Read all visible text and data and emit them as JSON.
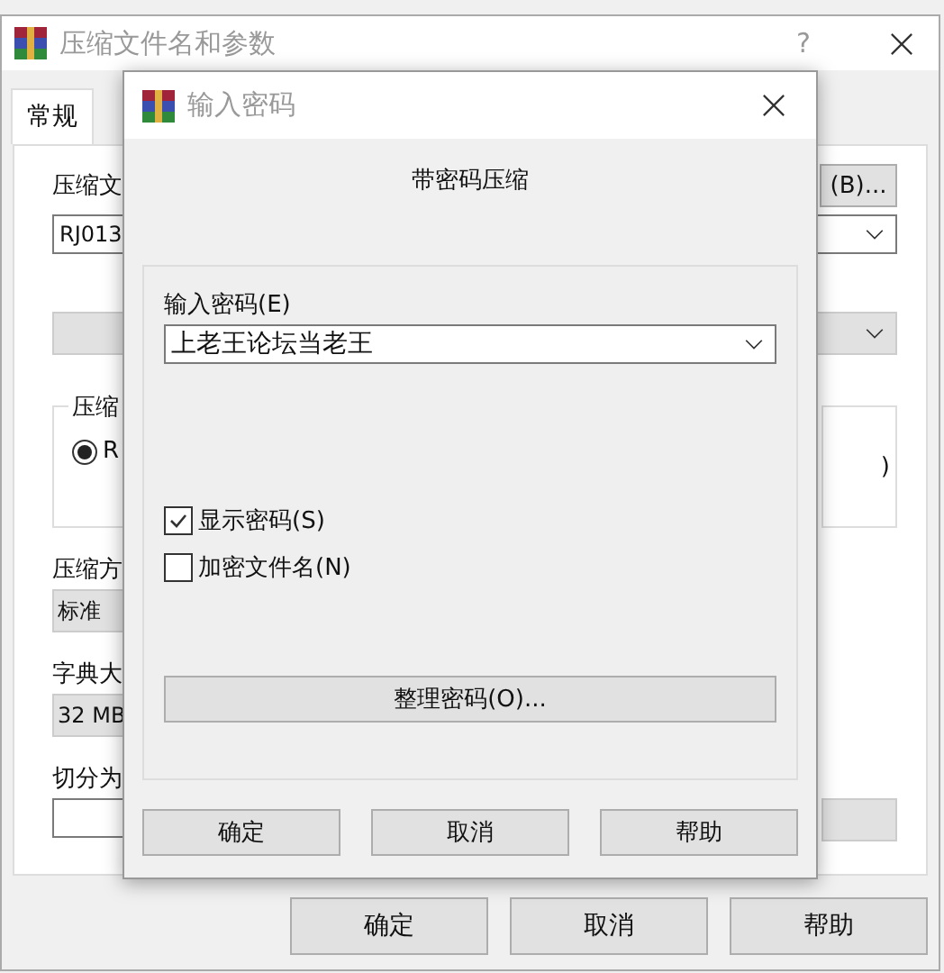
{
  "main_window": {
    "title": "压缩文件名和参数",
    "help": "?",
    "tabs": [
      {
        "label": "常规",
        "selected": true
      }
    ],
    "archive_label": "压缩文",
    "browse_button": "(B)...",
    "archive_name": "RJ013",
    "group_label": "压缩",
    "format_options": [
      {
        "label": "R",
        "selected": true
      }
    ],
    "right_group_text": ")",
    "method_label": "压缩方",
    "method_value": "标准",
    "dict_label": "字典大",
    "dict_value": "32 MB",
    "split_label": "切分为",
    "buttons": [
      "确定",
      "取消",
      "帮助"
    ]
  },
  "password_dialog": {
    "title": "输入密码",
    "heading": "带密码压缩",
    "password_label": "输入密码(E)",
    "password_value": "上老王论坛当老王",
    "options": [
      {
        "label": "显示密码(S)",
        "checked": true
      },
      {
        "label": "加密文件名(N)",
        "checked": false
      }
    ],
    "organize_button": "整理密码(O)...",
    "buttons": [
      "确定",
      "取消",
      "帮助"
    ]
  }
}
